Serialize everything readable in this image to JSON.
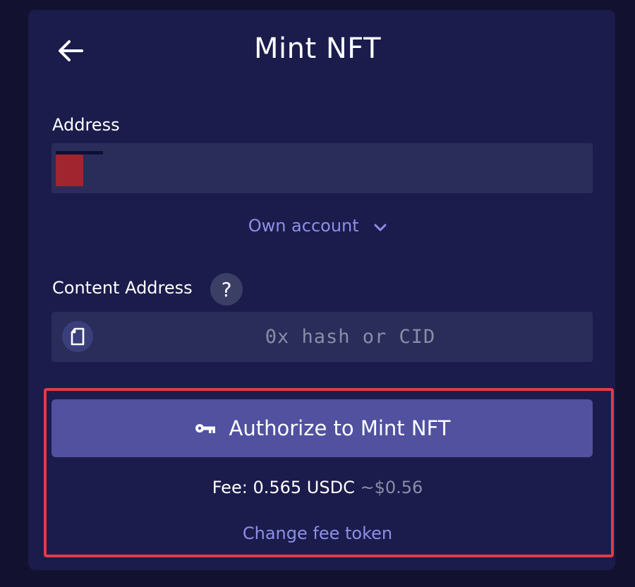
{
  "header": {
    "title": "Mint NFT",
    "back_icon": "arrow-left-icon"
  },
  "address": {
    "label": "Address",
    "value": ""
  },
  "account_selector": {
    "label": "Own account",
    "icon": "chevron-down-icon"
  },
  "content_address": {
    "label": "Content Address",
    "help_label": "?",
    "placeholder": "0x hash or CID",
    "paste_icon": "clipboard-icon"
  },
  "authorize": {
    "label": "Authorize to Mint NFT",
    "icon": "key-icon"
  },
  "fee": {
    "prefix": "Fee: ",
    "amount": "0.565",
    "token": "USDC",
    "usd": "~$0.56"
  },
  "change_fee": {
    "label": "Change fee token"
  },
  "colors": {
    "background": "#121230",
    "card": "#1b1c4c",
    "field": "#2a2d5a",
    "accent": "#8d8fe6",
    "button": "#5151a0",
    "highlight": "#e03c46"
  }
}
